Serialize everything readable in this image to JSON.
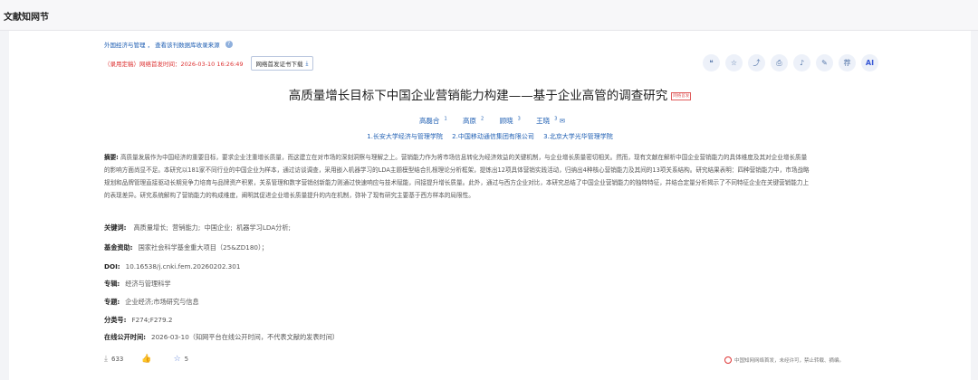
{
  "header": {
    "title": "文献知网节"
  },
  "meta": {
    "source_links": "外国经济与管理 ， 查看该刊数据库收录来源",
    "preprint_notice": "（录用定稿）网络首发时间：2026-03-10 16:26:49",
    "download_label": "网络首发证书下载"
  },
  "toolbar": {
    "icons": [
      "quote-icon",
      "star-icon",
      "share-icon",
      "print-icon",
      "bell-icon",
      "edit-icon",
      "recommend-icon",
      "ai-icon"
    ],
    "recommend_label": "荐",
    "ai_label": "AI"
  },
  "article": {
    "title": "高质量增长目标下中国企业营销能力构建——基于企业高管的调查研究",
    "badge": "网络首发",
    "authors": [
      {
        "name": "高磊合",
        "sup": "1"
      },
      {
        "name": "高原",
        "sup": "2"
      },
      {
        "name": "顾晓",
        "sup": "3"
      },
      {
        "name": "王晓",
        "sup": "3"
      }
    ],
    "affiliations": [
      "1.长安大学经济与管理学院",
      "2.中国移动通信集团有限公司",
      "3.北京大学光华管理学院"
    ],
    "abstract_label": "摘要:",
    "abstract": "高质量发展作为中国经济的重要目标，要求企业注重增长质量，而这建立在对市场的深刻洞察与理解之上。营销能力作为将市场信息转化为经济效益的关键机制，与企业增长质量密切相关。然而，现有文献在解析中国企业营销能力的具体维度及其对企业增长质量的影响方面尚显不足。本研究以181家不同行业的中国企业为样本，通过访谈调查，采用嵌入机器学习的LDA主题模型结合扎根理论分析框架，提炼出12项具体营销实践活动，归纳出4种核心营销能力及其间的13项关系结构。研究结果表明：四种营销能力中，市场战略规划和品牌管理直接驱动长期竞争力培育与品牌资产积累，关系管理和数字营销创新能力则通过快速响应与技术赋能，间接提升增长质量。此外，通过与西方企业对比，本研究总结了中国企业营销能力的独特特征，并结合定量分析揭示了不同特征企业在关键营销能力上的表现差异。研究系统解构了营销能力的构成维度，阐明其促进企业增长质量提升的内在机制，弥补了现有研究主要基于西方样本的局限性。",
    "keywords_label": "关键词:",
    "keywords": [
      "高质量增长;",
      "营销能力;",
      "中国企业;",
      "机器学习LDA分析;"
    ],
    "funding_label": "基金资助:",
    "funding": "国家社会科学基金重大项目（25&ZD180）；",
    "doi_label": "DOI:",
    "doi": "10.16538/j.cnki.fem.20260202.301",
    "series_label": "专辑:",
    "series": "经济与管理科学",
    "topic_label": "专题:",
    "topic": "企业经济;市场研究与信息",
    "class_label": "分类号:",
    "class_no": "F274;F279.2",
    "online_label": "在线公开时间:",
    "online_time": "2026-03-10（知网平台在线公开时间，不代表文献的发表时间）"
  },
  "footer": {
    "downloads": "633",
    "favorites": "5",
    "copyright": "中国知网网络首发，未经许可，禁止转载、摘编。"
  }
}
